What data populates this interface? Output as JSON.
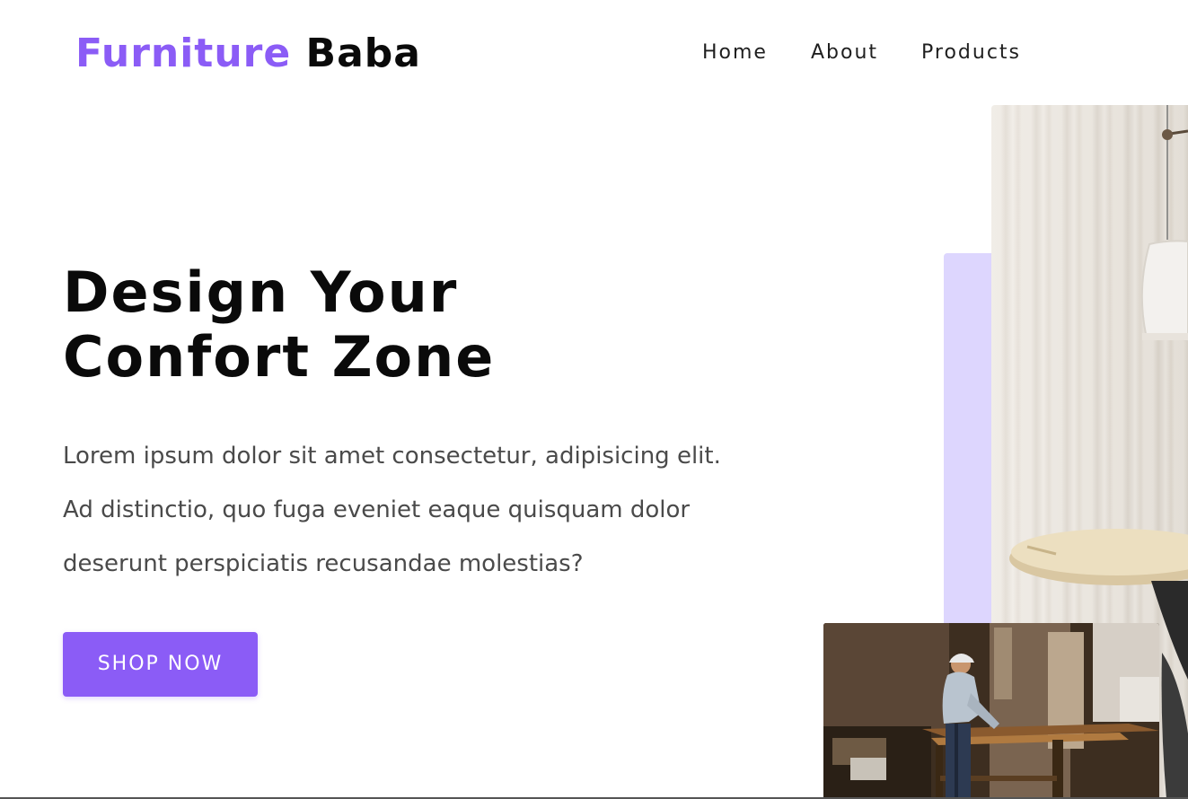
{
  "brand": {
    "accent": "Furniture",
    "rest": "Baba",
    "accent_color": "#8b5cf6"
  },
  "nav": {
    "items": [
      {
        "label": "Home"
      },
      {
        "label": "About"
      },
      {
        "label": "Products"
      }
    ]
  },
  "hero": {
    "title_lines": [
      "Design Your",
      "Confort Zone"
    ],
    "description_lines": [
      "Lorem ipsum dolor sit amet consectetur, adipisicing elit.",
      "Ad distinctio, quo fuga eveniet eaque quisquam dolor",
      "deserunt perspiciatis recusandae molestias?"
    ],
    "cta_label": "SHOP NOW",
    "cta_color": "#8b5cf6",
    "panel_color": "#ddd6fe"
  },
  "images": {
    "room": {
      "depicts": "lamp-and-round-table"
    },
    "workshop": {
      "depicts": "man-working-wood-in-workshop"
    }
  }
}
